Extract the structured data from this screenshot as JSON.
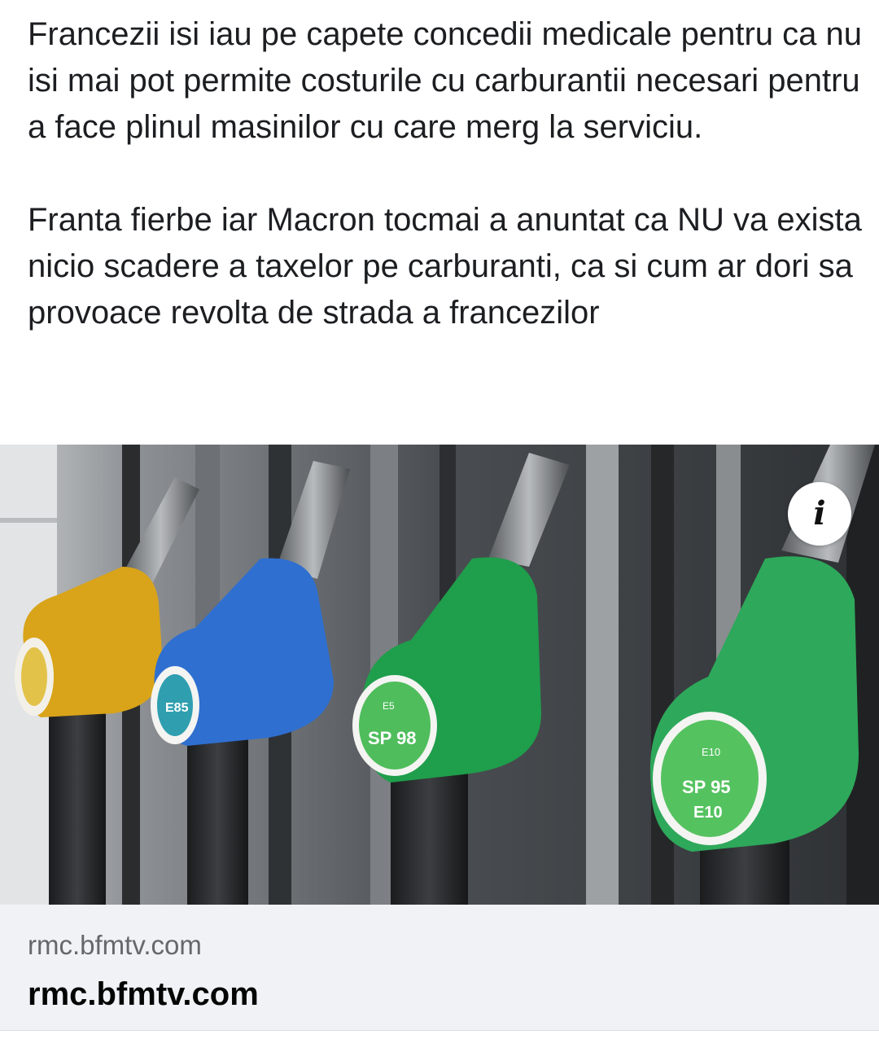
{
  "post": {
    "paragraph_1": "Francezii isi iau pe capete concedii medicale pentru ca nu isi mai pot permite costurile cu carburantii necesari pentru a face plinul masinilor cu care merg la serviciu.",
    "paragraph_2": "Franta fierbe iar Macron tocmai a anuntat ca NU va exista nicio scadere a taxelor pe carburanti, ca si cum ar dori sa provoace revolta de strada a francezilor"
  },
  "link_preview": {
    "image": {
      "nozzles": [
        {
          "color": "#d9a419",
          "label": ""
        },
        {
          "color": "#2f6fd0",
          "label": "E85"
        },
        {
          "color": "#1f9e4b",
          "label": "SP 98",
          "sublabel": "E5"
        },
        {
          "color": "#2ea85a",
          "label": "SP 95",
          "sublabel": "E10"
        }
      ]
    },
    "info_icon": "info-icon",
    "info_glyph": "i",
    "domain": "rmc.bfmtv.com",
    "title": "rmc.bfmtv.com"
  }
}
